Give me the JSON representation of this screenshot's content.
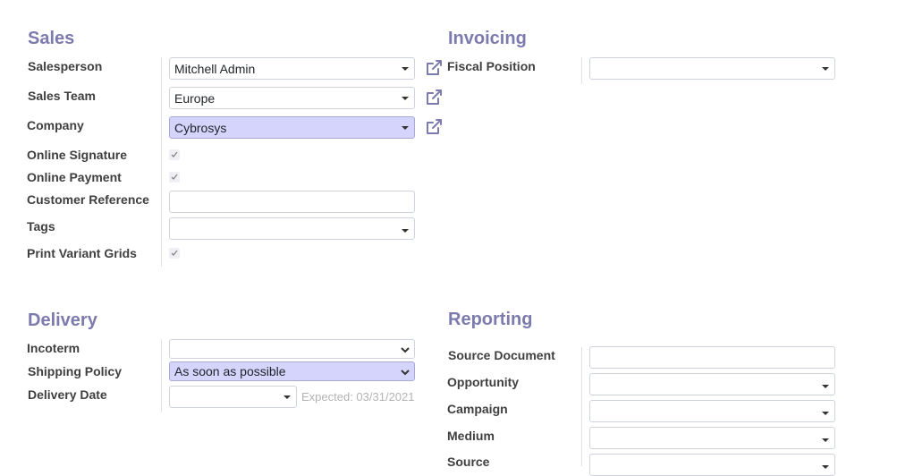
{
  "sales": {
    "title": "Sales",
    "salesperson": {
      "label": "Salesperson",
      "value": "Mitchell Admin"
    },
    "sales_team": {
      "label": "Sales Team",
      "value": "Europe"
    },
    "company": {
      "label": "Company",
      "value": "Cybrosys"
    },
    "online_signature": {
      "label": "Online Signature",
      "checked": true
    },
    "online_payment": {
      "label": "Online Payment",
      "checked": true
    },
    "customer_reference": {
      "label": "Customer Reference",
      "value": ""
    },
    "tags": {
      "label": "Tags",
      "value": ""
    },
    "print_variant_grids": {
      "label": "Print Variant Grids",
      "checked": true
    }
  },
  "invoicing": {
    "title": "Invoicing",
    "fiscal_position": {
      "label": "Fiscal Position",
      "value": ""
    }
  },
  "delivery": {
    "title": "Delivery",
    "incoterm": {
      "label": "Incoterm",
      "value": ""
    },
    "shipping_policy": {
      "label": "Shipping Policy",
      "value": "As soon as possible"
    },
    "delivery_date": {
      "label": "Delivery Date",
      "value": "",
      "expected": "Expected: 03/31/2021"
    }
  },
  "reporting": {
    "title": "Reporting",
    "source_document": {
      "label": "Source Document",
      "value": ""
    },
    "opportunity": {
      "label": "Opportunity",
      "value": ""
    },
    "campaign": {
      "label": "Campaign",
      "value": ""
    },
    "medium": {
      "label": "Medium",
      "value": ""
    },
    "source": {
      "label": "Source",
      "value": ""
    }
  },
  "colors": {
    "section_title": "#7c7bad",
    "highlight": "#d4d4fd"
  }
}
